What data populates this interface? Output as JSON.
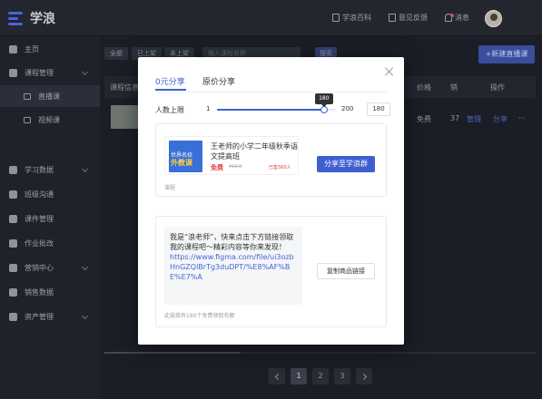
{
  "app": {
    "logo_text": "学浪"
  },
  "topbar": {
    "encyclopedia": "学浪百科",
    "feedback": "意见反馈",
    "messages": "消息"
  },
  "sidebar": {
    "home": "主页",
    "course_mgmt": "课程管理",
    "live_course": "直播课",
    "video_course": "视频课",
    "learning_data": "学习数据",
    "class_comm": "班级沟通",
    "courseware": "课件管理",
    "homework": "作业批改",
    "marketing": "营销中心",
    "sales_data": "销售数据",
    "assets": "资产管理"
  },
  "filters": {
    "all": "全部",
    "listed": "已上架",
    "unlisted": "未上架",
    "search_placeholder": "输入课程名称",
    "search_button": "搜索"
  },
  "new_live_button": "+新建直播课",
  "table": {
    "headers": {
      "info": "课程信息",
      "price": "价格",
      "sales": "销",
      "actions": "操作"
    },
    "row": {
      "price": "免费",
      "sales": "37",
      "manage": "管理",
      "share": "分享",
      "more": "···"
    }
  },
  "pagination": {
    "pages": [
      "1",
      "2",
      "3"
    ],
    "current": "1"
  },
  "modal": {
    "tabs": [
      "0元分享",
      "原价分享"
    ],
    "active_tab": 0,
    "limit": {
      "label": "人数上限",
      "min": "1",
      "max": "200",
      "value": "180",
      "fraction": 0.8995
    },
    "course": {
      "thumb_line1": "世界名校",
      "thumb_line2": "外教课",
      "title": "王老师的小学二年级秋季语文提高班",
      "price": "免费",
      "original_price": "¥99.6",
      "sold": "已售560人",
      "type": "课程",
      "share_button": "分享至学浪群"
    },
    "message": {
      "text": "我是“浪老师”，快来点击下方链接领取我的课程吧～精彩内容等你来发现！",
      "link": "https://www.figma.com/file/ui3ozbHnGZQlBrTg3duDPT/%E8%AF%BE%E7%A",
      "copy_button": "复制商品链接",
      "note": "此链接有180个免费领取名额"
    }
  }
}
